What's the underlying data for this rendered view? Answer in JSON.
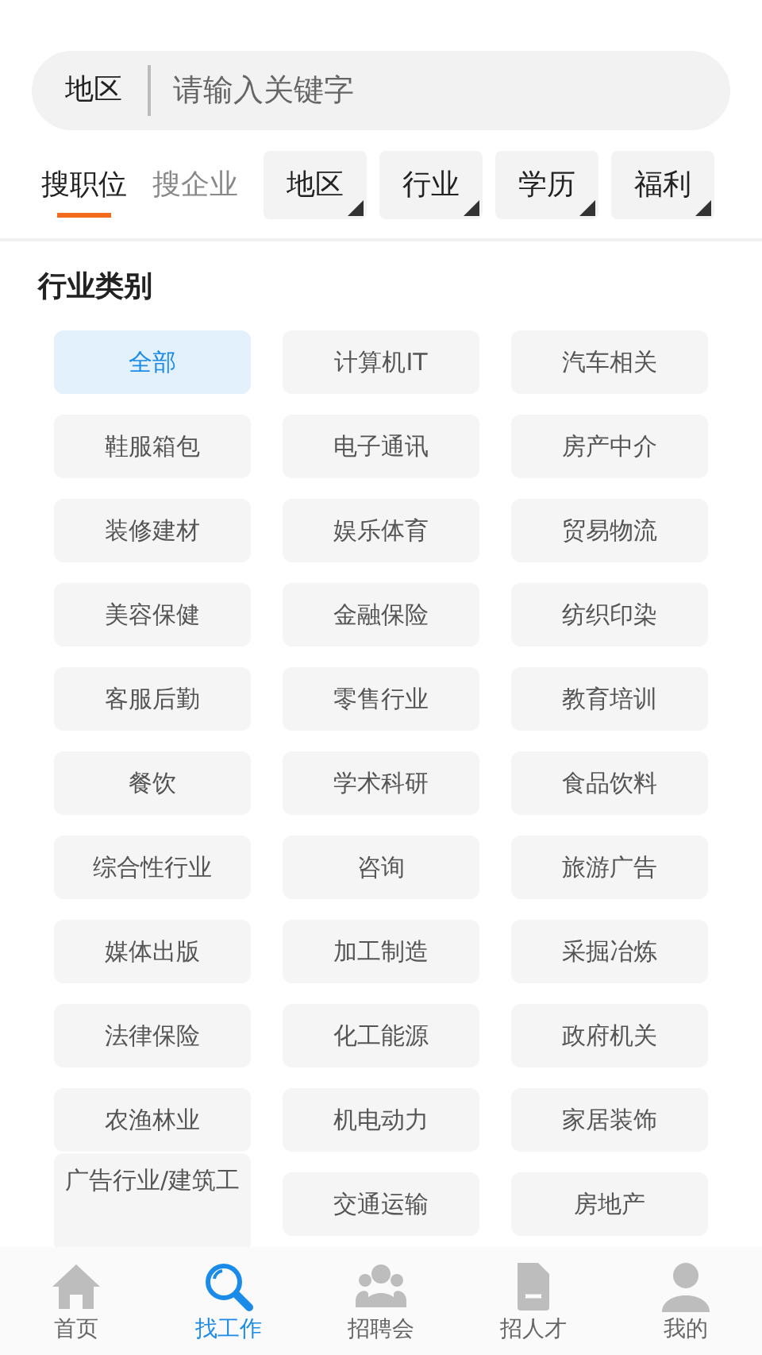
{
  "search": {
    "region": "地区",
    "placeholder": "请输入关键字"
  },
  "search_tabs": [
    {
      "label": "搜职位",
      "selected": true
    },
    {
      "label": "搜企业",
      "selected": false
    }
  ],
  "filters": [
    {
      "label": "地区"
    },
    {
      "label": "行业"
    },
    {
      "label": "学历"
    },
    {
      "label": "福利"
    }
  ],
  "section_title": "行业类别",
  "industries": [
    {
      "label": "全部",
      "selected": true
    },
    {
      "label": "计算机IT",
      "selected": false
    },
    {
      "label": "汽车相关",
      "selected": false
    },
    {
      "label": "鞋服箱包",
      "selected": false
    },
    {
      "label": "电子通讯",
      "selected": false
    },
    {
      "label": "房产中介",
      "selected": false
    },
    {
      "label": "装修建材",
      "selected": false
    },
    {
      "label": "娱乐体育",
      "selected": false
    },
    {
      "label": "贸易物流",
      "selected": false
    },
    {
      "label": "美容保健",
      "selected": false
    },
    {
      "label": "金融保险",
      "selected": false
    },
    {
      "label": "纺织印染",
      "selected": false
    },
    {
      "label": "客服后勤",
      "selected": false
    },
    {
      "label": "零售行业",
      "selected": false
    },
    {
      "label": "教育培训",
      "selected": false
    },
    {
      "label": "餐饮",
      "selected": false
    },
    {
      "label": "学术科研",
      "selected": false
    },
    {
      "label": "食品饮料",
      "selected": false
    },
    {
      "label": "综合性行业",
      "selected": false
    },
    {
      "label": "咨询",
      "selected": false
    },
    {
      "label": "旅游广告",
      "selected": false
    },
    {
      "label": "媒体出版",
      "selected": false
    },
    {
      "label": "加工制造",
      "selected": false
    },
    {
      "label": "采掘冶炼",
      "selected": false
    },
    {
      "label": "法律保险",
      "selected": false
    },
    {
      "label": "化工能源",
      "selected": false
    },
    {
      "label": "政府机关",
      "selected": false
    },
    {
      "label": "农渔林业",
      "selected": false
    },
    {
      "label": "机电动力",
      "selected": false
    },
    {
      "label": "家居装饰",
      "selected": false
    },
    {
      "label": "广告行业/建筑工",
      "selected": false,
      "kind": "wrapped"
    },
    {
      "label": "交通运输",
      "selected": false
    },
    {
      "label": "房地产",
      "selected": false
    }
  ],
  "bottom_nav": [
    {
      "label": "首页",
      "kind": "home",
      "selected": false
    },
    {
      "label": "找工作",
      "kind": "search",
      "selected": true
    },
    {
      "label": "招聘会",
      "kind": "fair",
      "selected": false
    },
    {
      "label": "招人才",
      "kind": "doc",
      "selected": false
    },
    {
      "label": "我的",
      "kind": "user",
      "selected": false
    }
  ]
}
